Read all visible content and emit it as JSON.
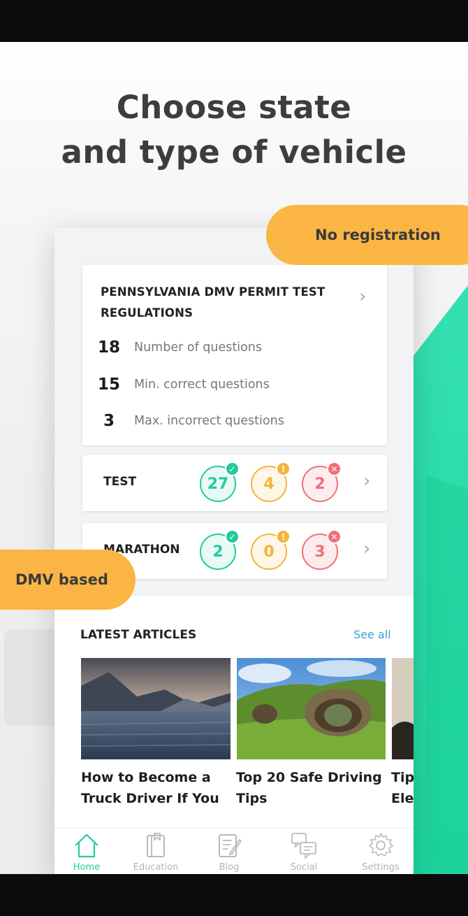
{
  "promo": {
    "headline_line1": "Choose state",
    "headline_line2": "and type of vehicle",
    "badge_right": "No registration",
    "badge_left": "DMV based"
  },
  "regulations": {
    "title": "PENNSYLVANIA DMV PERMIT TEST REGULATIONS",
    "stats": [
      {
        "value": "18",
        "label": "Number of questions"
      },
      {
        "value": "15",
        "label": "Min. correct questions"
      },
      {
        "value": "3",
        "label": "Max. incorrect questions"
      }
    ]
  },
  "modes": [
    {
      "label": "TEST",
      "correct": "27",
      "skipped": "4",
      "wrong": "2"
    },
    {
      "label": "MARATHON",
      "correct": "2",
      "skipped": "0",
      "wrong": "3"
    }
  ],
  "articles": {
    "section_title": "LATEST ARTICLES",
    "see_all": "See all",
    "items": [
      {
        "title": "How to Become a Truck Driver If You"
      },
      {
        "title": "Top 20 Safe Driving Tips"
      },
      {
        "title": "Tips Elec"
      }
    ]
  },
  "tabs": [
    {
      "label": "Home",
      "icon": "home-icon",
      "active": true
    },
    {
      "label": "Education",
      "icon": "book-icon"
    },
    {
      "label": "Blog",
      "icon": "notepad-pencil-icon"
    },
    {
      "label": "Social",
      "icon": "chat-bubbles-icon"
    },
    {
      "label": "Settings",
      "icon": "gear-icon"
    }
  ],
  "colors": {
    "accent_green": "#24c9a0",
    "warning_yellow": "#f4b33a",
    "error_red": "#f26f78",
    "pill_orange": "#fbb544",
    "link_blue": "#3aa0d6"
  }
}
